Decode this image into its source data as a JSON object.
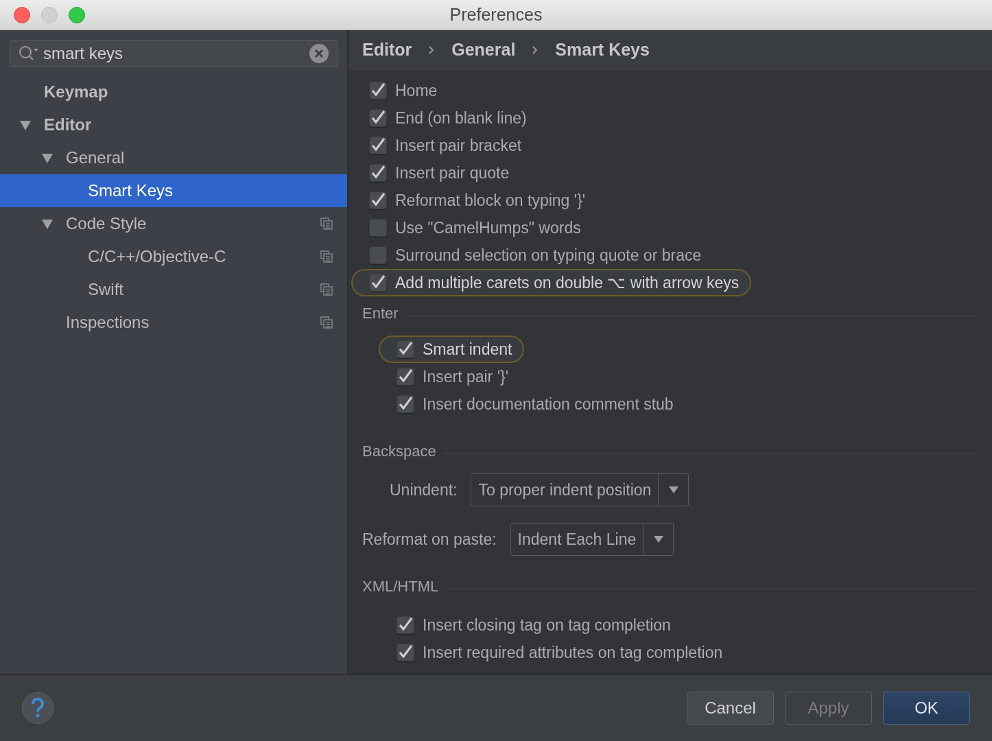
{
  "window": {
    "title": "Preferences"
  },
  "search": {
    "value": "smart keys"
  },
  "sidebar": {
    "items": [
      {
        "label": "Keymap",
        "bold": true,
        "selected": false,
        "scope_icon": false
      },
      {
        "label": "Editor",
        "bold": true,
        "selected": false,
        "scope_icon": false,
        "expanded": true,
        "children": [
          {
            "label": "General",
            "bold": false,
            "selected": false,
            "scope_icon": false,
            "expanded": true,
            "children": [
              {
                "label": "Smart Keys",
                "bold": false,
                "selected": true,
                "scope_icon": false
              }
            ]
          },
          {
            "label": "Code Style",
            "bold": false,
            "selected": false,
            "scope_icon": true,
            "expanded": true,
            "children": [
              {
                "label": "C/C++/Objective-C",
                "bold": false,
                "selected": false,
                "scope_icon": true
              },
              {
                "label": "Swift",
                "bold": false,
                "selected": false,
                "scope_icon": true
              }
            ]
          },
          {
            "label": "Inspections",
            "bold": false,
            "selected": false,
            "scope_icon": true
          }
        ]
      }
    ]
  },
  "breadcrumb": [
    "Editor",
    "General",
    "Smart Keys"
  ],
  "options": [
    {
      "label": "Home",
      "checked": true,
      "highlighted": false
    },
    {
      "label": "End (on blank line)",
      "checked": true,
      "highlighted": false
    },
    {
      "label": "Insert pair bracket",
      "checked": true,
      "highlighted": false
    },
    {
      "label": "Insert pair quote",
      "checked": true,
      "highlighted": false
    },
    {
      "label": "Reformat block on typing '}'",
      "checked": true,
      "highlighted": false
    },
    {
      "label": "Use \"CamelHumps\" words",
      "checked": false,
      "highlighted": false
    },
    {
      "label": "Surround selection on typing quote or brace",
      "checked": false,
      "highlighted": false
    },
    {
      "label": "Add multiple carets on double ⌥ with arrow keys",
      "checked": true,
      "highlighted": true
    }
  ],
  "enter": {
    "title": "Enter",
    "options": [
      {
        "label": "Smart indent",
        "checked": true,
        "highlighted": true
      },
      {
        "label": "Insert pair '}'",
        "checked": true,
        "highlighted": false
      },
      {
        "label": "Insert documentation comment stub",
        "checked": true,
        "highlighted": false
      }
    ]
  },
  "backspace": {
    "title": "Backspace",
    "fields": [
      {
        "label": "Unindent:",
        "value": "To proper indent position",
        "indented": true
      },
      {
        "label": "Reformat on paste:",
        "value": "Indent Each Line",
        "indented": false
      }
    ]
  },
  "xml": {
    "title": "XML/HTML",
    "options": [
      {
        "label": "Insert closing tag on tag completion",
        "checked": true,
        "highlighted": false
      },
      {
        "label": "Insert required attributes on tag completion",
        "checked": true,
        "highlighted": false
      }
    ]
  },
  "buttons": [
    {
      "label": "Cancel",
      "kind": "normal",
      "disabled": false
    },
    {
      "label": "Apply",
      "kind": "normal",
      "disabled": true
    },
    {
      "label": "OK",
      "kind": "default",
      "disabled": false
    }
  ]
}
